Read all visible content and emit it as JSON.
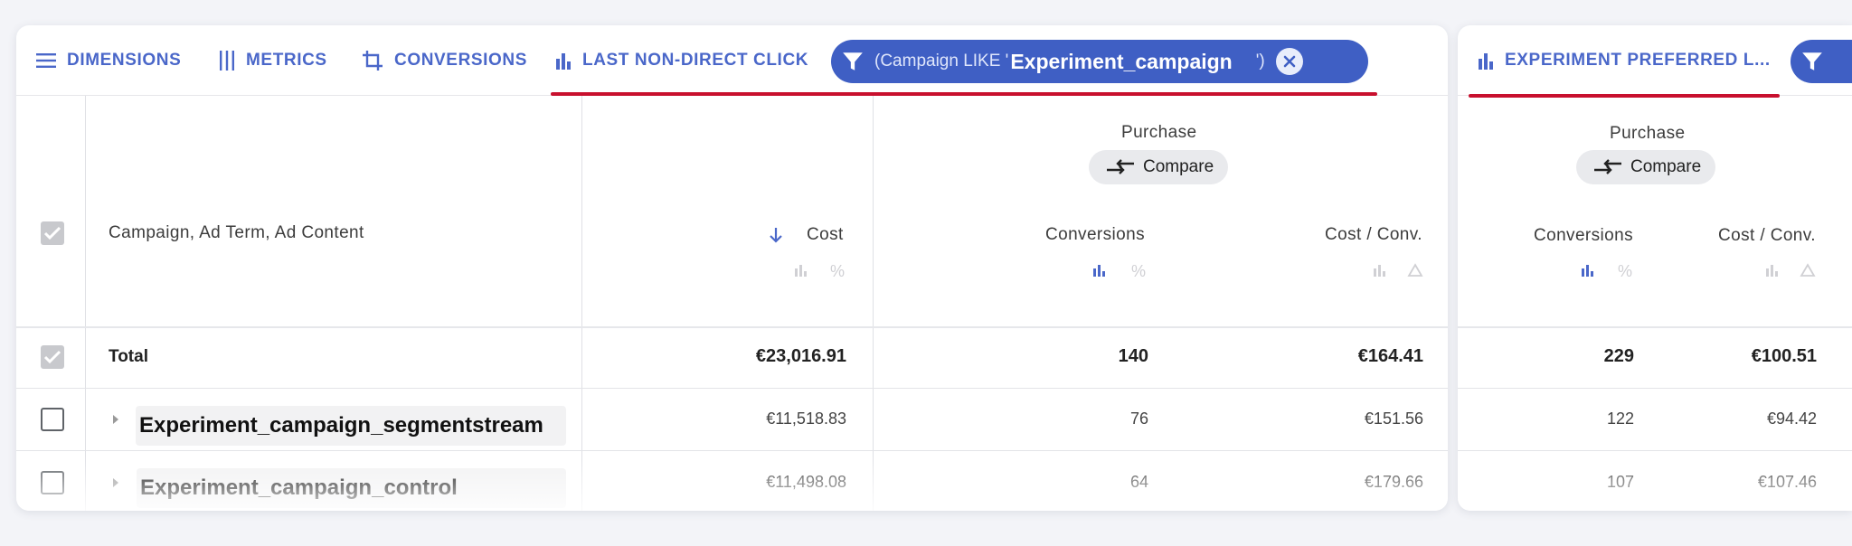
{
  "toolbar": {
    "dimensions_label": "DIMENSIONS",
    "metrics_label": "METRICS",
    "conversions_label": "CONVERSIONS",
    "attribution_label": "LAST NON-DIRECT CLICK",
    "filter_prefix": "(Campaign LIKE '",
    "filter_value": "Experiment_campaign",
    "filter_suffix": "')"
  },
  "side_toolbar": {
    "attribution_label": "EXPERIMENT PREFERRED L..."
  },
  "table": {
    "dimension_header": "Campaign, Ad Term, Ad Content",
    "cost_header": "Cost",
    "conversion_group": "Purchase",
    "compare_label": "Compare",
    "conversions_header": "Conversions",
    "cost_per_conv_header": "Cost / Conv.",
    "total_label": "Total",
    "total": {
      "cost": "€23,016.91",
      "conversions": "140",
      "cost_per_conv": "€164.41"
    },
    "rows": [
      {
        "name": "Experiment_campaign_segmentstream",
        "cost": "€11,518.83",
        "conversions": "76",
        "cost_per_conv": "€151.56"
      },
      {
        "name": "Experiment_campaign_control",
        "cost": "€11,498.08",
        "conversions": "64",
        "cost_per_conv": "€179.66"
      }
    ]
  },
  "side_table": {
    "conversion_group": "Purchase",
    "compare_label": "Compare",
    "conversions_header": "Conversions",
    "cost_per_conv_header": "Cost / Conv.",
    "total": {
      "conversions": "229",
      "cost_per_conv": "€100.51"
    },
    "rows": [
      {
        "conversions": "122",
        "cost_per_conv": "€94.42"
      },
      {
        "conversions": "107",
        "cost_per_conv": "€107.46"
      }
    ]
  },
  "colors": {
    "accent": "#4a67c9",
    "chip": "#3f5fc4",
    "underline": "#c8102e"
  }
}
